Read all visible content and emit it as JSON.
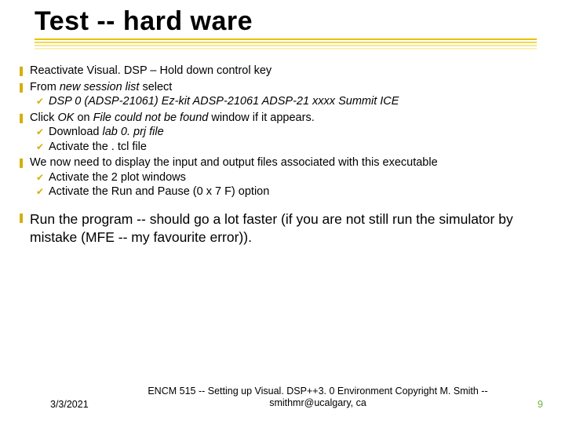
{
  "title": "Test -- hard ware",
  "b1": {
    "p1": "Reactivate Visual. DSP – Hold down control key",
    "p2_a": "From ",
    "p2_b": "new session list ",
    "p2_c": "select",
    "s1": "DSP 0 (ADSP-21061) Ez-kit ADSP-21061 ADSP-21 xxxx Summit ICE",
    "p3_a": "Click ",
    "p3_b": "OK ",
    "p3_c": "on ",
    "p3_d": "File could not be found  ",
    "p3_e": "window if it appears.",
    "s2_a": "Download ",
    "s2_b": "lab 0. prj file",
    "s3": "Activate the . tcl file",
    "p4": "We now need to display the input and output files associated with this executable",
    "s4": "Activate the 2 plot windows",
    "s5": "Activate the Run and Pause (0 x 7 F) option",
    "p5": "Run the program -- should go a lot faster (if you are not still run the simulator by mistake (MFE -- my favourite error))."
  },
  "footer": {
    "date": "3/3/2021",
    "mid": "ENCM 515 -- Setting up Visual. DSP++3. 0 Environment Copyright M. Smith -- smithmr@ucalgary, ca",
    "page": "9"
  }
}
